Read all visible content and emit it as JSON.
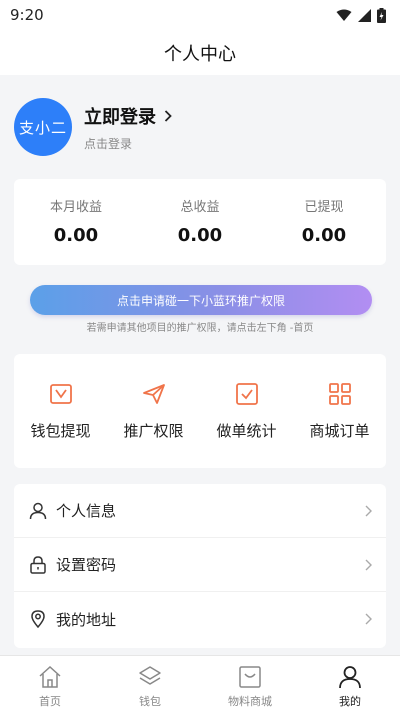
{
  "status_bar": {
    "time": "9:20"
  },
  "header": {
    "title": "个人中心"
  },
  "profile": {
    "avatar_text": "支小二",
    "login_title": "立即登录",
    "login_subtitle": "点击登录"
  },
  "stats": [
    {
      "label": "本月收益",
      "value": "0.00"
    },
    {
      "label": "总收益",
      "value": "0.00"
    },
    {
      "label": "已提现",
      "value": "0.00"
    }
  ],
  "apply": {
    "button_label": "点击申请碰一下小蓝环推广权限",
    "hint": "若需申请其他项目的推广权限，请点击左下角 -首页"
  },
  "shortcuts": [
    {
      "label": "钱包提现",
      "icon": "wallet-shield-icon"
    },
    {
      "label": "推广权限",
      "icon": "paper-plane-icon"
    },
    {
      "label": "做单统计",
      "icon": "checkbox-icon"
    },
    {
      "label": "商城订单",
      "icon": "grid-icon"
    }
  ],
  "menu": [
    {
      "label": "个人信息",
      "icon": "user-icon"
    },
    {
      "label": "设置密码",
      "icon": "lock-icon"
    },
    {
      "label": "我的地址",
      "icon": "location-pin-icon"
    }
  ],
  "tabs": [
    {
      "label": "首页",
      "icon": "home-icon"
    },
    {
      "label": "钱包",
      "icon": "layers-icon"
    },
    {
      "label": "物料商城",
      "icon": "inbox-icon"
    },
    {
      "label": "我的",
      "icon": "person-icon"
    }
  ],
  "colors": {
    "accent_orange": "#f0744a",
    "avatar_blue": "#2d7ff9",
    "gradient_start": "#5ba0e8",
    "gradient_end": "#b28ef2"
  }
}
